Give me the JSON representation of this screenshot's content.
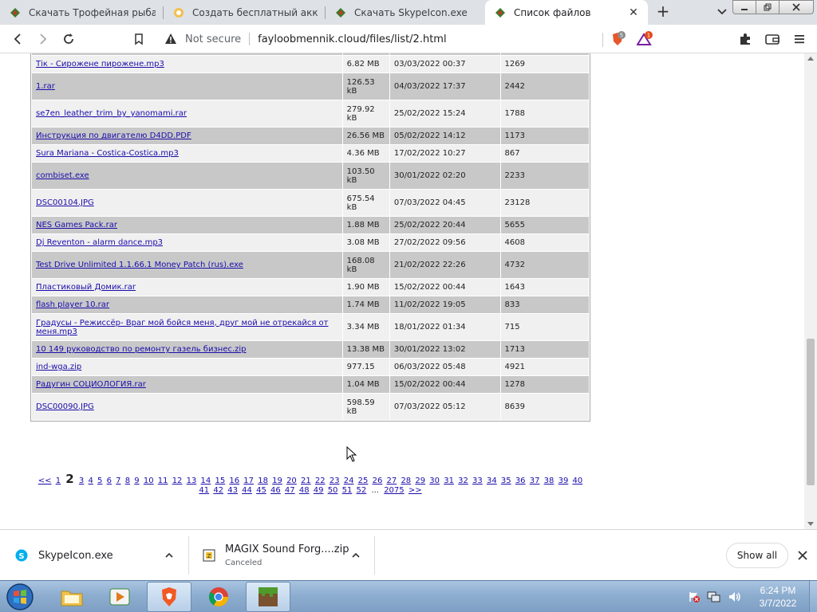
{
  "browser": {
    "tabs": [
      {
        "label": "Скачать Трофейная рыбалка"
      },
      {
        "label": "Создать бесплатный аккаунт"
      },
      {
        "label": "Скачать SkypeIcon.exe"
      },
      {
        "label": "Список файлов",
        "active": true
      }
    ],
    "address": {
      "security": "Not secure",
      "url": "fayloobmennik.cloud/files/list/2.html"
    },
    "shield_badge": "5",
    "rewards_badge": "1"
  },
  "files": {
    "rows": [
      {
        "name": "Тік - Сирожене пирожене.mp3",
        "size": "6.82 MB",
        "date": "03/03/2022 00:37",
        "downloads": "1269",
        "shade": "w"
      },
      {
        "name": "1.rar",
        "size": "126.53 kB",
        "date": "04/03/2022 17:37",
        "downloads": "2442",
        "shade": "g"
      },
      {
        "name": "se7en_leather_trim_by_yanomami.rar",
        "size": "279.92 kB",
        "date": "25/02/2022 15:24",
        "downloads": "1788",
        "shade": "w"
      },
      {
        "name": "Инструкция по двигателю D4DD.PDF",
        "size": "26.56 MB",
        "date": "05/02/2022 14:12",
        "downloads": "1173",
        "shade": "g"
      },
      {
        "name": "Sura Mariana - Costica-Costica.mp3",
        "size": "4.36 MB",
        "date": "17/02/2022 10:27",
        "downloads": "867",
        "shade": "w"
      },
      {
        "name": "combiset.exe",
        "size": "103.50 kB",
        "date": "30/01/2022 02:20",
        "downloads": "2233",
        "shade": "g"
      },
      {
        "name": "DSC00104.JPG",
        "size": "675.54 kB",
        "date": "07/03/2022 04:45",
        "downloads": "23128",
        "shade": "w"
      },
      {
        "name": "NES Games Pack.rar",
        "size": "1.88 MB",
        "date": "25/02/2022 20:44",
        "downloads": "5655",
        "shade": "g"
      },
      {
        "name": "Dj Reventon - alarm dance.mp3",
        "size": "3.08 MB",
        "date": "27/02/2022 09:56",
        "downloads": "4608",
        "shade": "w"
      },
      {
        "name": "Test Drive Unlimited 1.1.66.1 Money Patch (rus).exe",
        "size": "168.08 kB",
        "date": "21/02/2022 22:26",
        "downloads": "4732",
        "shade": "g"
      },
      {
        "name": "Пластиковый Домик.rar",
        "size": "1.90 MB",
        "date": "15/02/2022 00:44",
        "downloads": "1643",
        "shade": "w"
      },
      {
        "name": "flash player 10.rar",
        "size": "1.74 MB",
        "date": "11/02/2022 19:05",
        "downloads": "833",
        "shade": "g"
      },
      {
        "name": "Градусы - Режиссёр- Враг мой бойся меня, друг мой не отрекайся от меня.mp3",
        "size": "3.34 MB",
        "date": "18/01/2022 01:34",
        "downloads": "715",
        "shade": "w"
      },
      {
        "name": "10 149 руководство по ремонту газель бизнес.zip",
        "size": "13.38 MB",
        "date": "30/01/2022 13:02",
        "downloads": "1713",
        "shade": "g"
      },
      {
        "name": "ind-wga.zip",
        "size": "977.15",
        "date": "06/03/2022 05:48",
        "downloads": "4921",
        "shade": "w"
      },
      {
        "name": "Радугин СОЦИОЛОГИЯ.rar",
        "size": "1.04 MB",
        "date": "15/02/2022 00:44",
        "downloads": "1278",
        "shade": "g"
      },
      {
        "name": "DSC00090.JPG",
        "size": "598.59 kB",
        "date": "07/03/2022 05:12",
        "downloads": "8639",
        "shade": "w"
      }
    ]
  },
  "pager": {
    "prev": "<<",
    "current": "2",
    "pages_before": [
      "1"
    ],
    "pages_after": [
      "3",
      "4",
      "5",
      "6",
      "7",
      "8",
      "9",
      "10",
      "11",
      "12",
      "13",
      "14",
      "15",
      "16",
      "17",
      "18",
      "19",
      "20",
      "21",
      "22",
      "23",
      "24",
      "25",
      "26",
      "27",
      "28",
      "29",
      "30",
      "31",
      "32",
      "33",
      "34",
      "35",
      "36",
      "37",
      "38",
      "39",
      "40",
      "41",
      "42",
      "43",
      "44",
      "45",
      "46",
      "47",
      "48",
      "49",
      "50",
      "51",
      "52"
    ],
    "ellipsis": "...",
    "last": "2075",
    "next": ">>"
  },
  "downloads": {
    "items": [
      {
        "name": "SkypeIcon.exe",
        "status": ""
      },
      {
        "name": "MAGIX Sound Forg....zip",
        "status": "Canceled"
      }
    ],
    "show_all": "Show all"
  },
  "taskbar": {
    "time": "6:24 PM",
    "date": "3/7/2022"
  }
}
